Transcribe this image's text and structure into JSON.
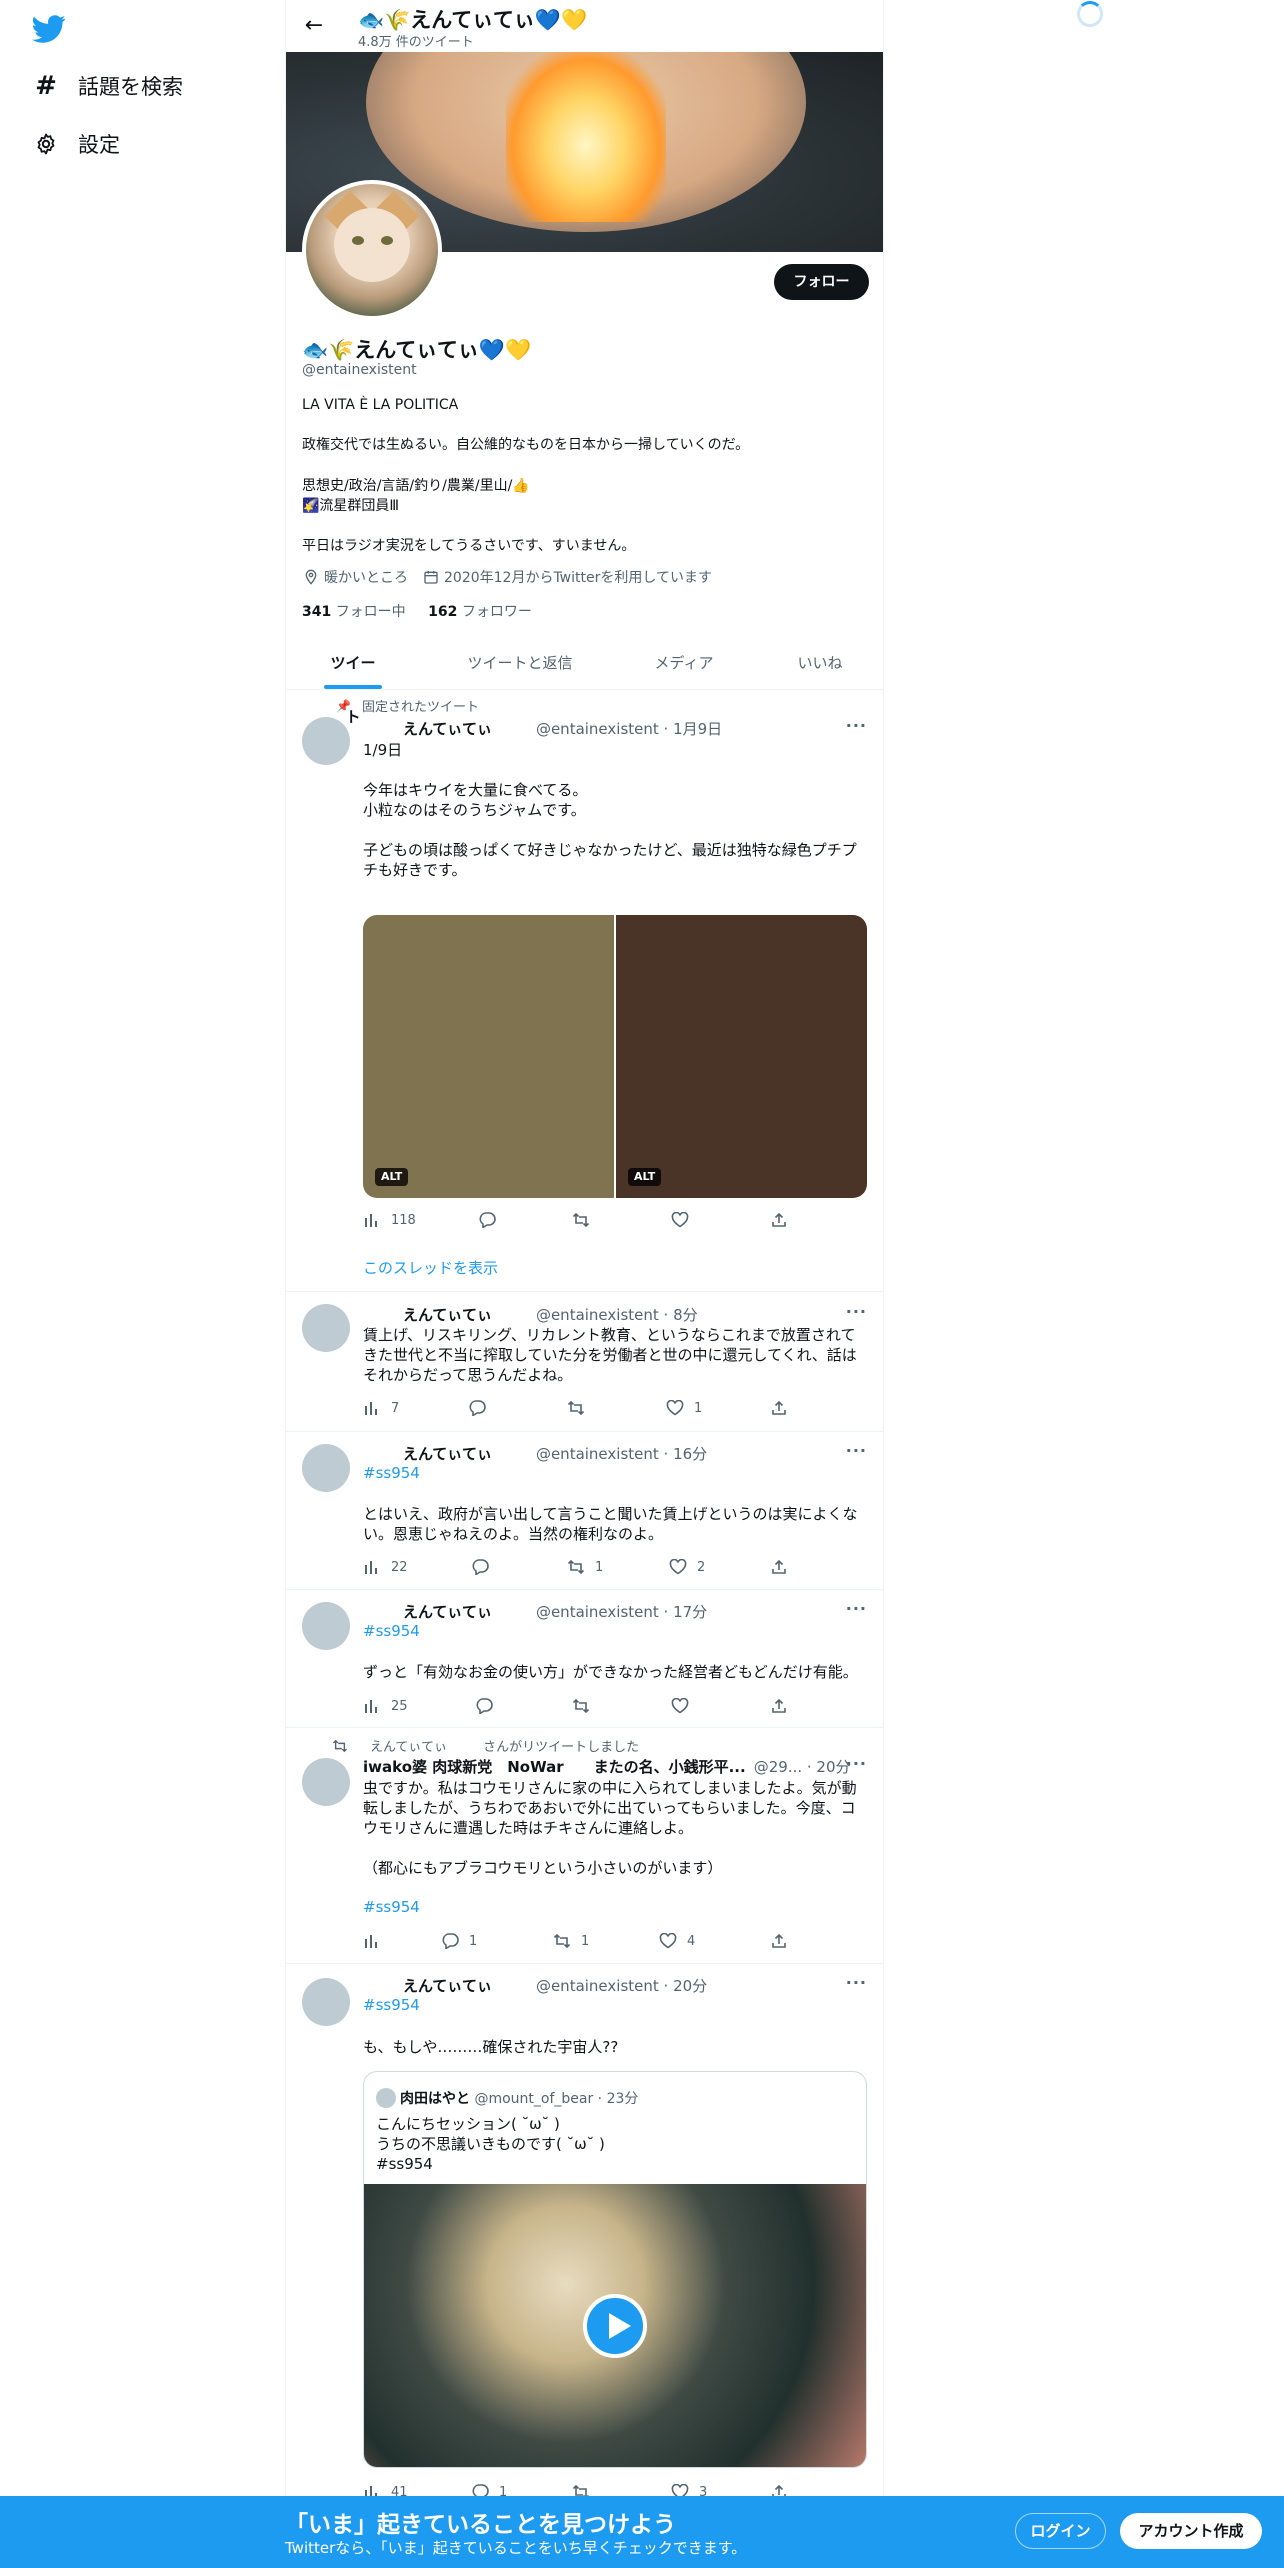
{
  "sidebar": {
    "explore_label": "話題を検索",
    "settings_label": "設定"
  },
  "header": {
    "name": "🐟🌾えんてぃてぃ💙💛",
    "tweet_count": "4.8万 件のツイート"
  },
  "profile": {
    "follow_label": "フォロー",
    "name": "🐟🌾えんてぃてぃ💙💛",
    "handle": "@entainexistent",
    "bio_line1": "LA VITA È LA POLITICA",
    "bio_line2": "政権交代では生ぬるい。自公維的なものを日本から一掃していくのだ。",
    "bio_line3": "思想史/政治/言語/釣り/農業/里山/👍",
    "bio_line4": "🌠流星群団員Ⅲ",
    "bio_line5": "平日はラジオ実況をしてうるさいです、すいません。",
    "location": "暖かいところ",
    "joined": "2020年12月からTwitterを利用しています",
    "following_count": "341",
    "following_label": "フォロー中",
    "followers_count": "162",
    "followers_label": "フォロワー"
  },
  "tabs": [
    "ツイート",
    "ツイートと返信",
    "メディア",
    "いいね"
  ],
  "pinned_label": "固定されたツイート",
  "retweeted_by": "えんてぃてぃ",
  "retweeted_suffix": "さんがリツイートしました",
  "thread_link": "このスレッドを表示",
  "alt_label": "ALT",
  "tweets": [
    {
      "name": "えんてぃてぃ",
      "meta": "@entainexistent · 1月9日",
      "lines": [
        "1/9日",
        "",
        "今年はキウイを大量に食べてる。",
        "小粒なのはそのうちジャムです。",
        "",
        "子どもの頃は酸っぱくて好きじゃなかったけど、最近は独特な緑色プチプ",
        "チも好きです。"
      ],
      "views": "118",
      "replies": "",
      "retweets": "",
      "likes": ""
    },
    {
      "name": "えんてぃてぃ",
      "meta": "@entainexistent · 8分",
      "lines": [
        "賃上げ、リスキリング、リカレント教育、というならこれまで放置されて",
        "きた世代と不当に搾取していた分を労働者と世の中に還元してくれ、話は",
        "それからだって思うんだよね。"
      ],
      "views": "7",
      "replies": "",
      "retweets": "",
      "likes": "1"
    },
    {
      "name": "えんてぃてぃ",
      "meta": "@entainexistent · 16分",
      "tag": "#ss954",
      "lines": [
        "とはいえ、政府が言い出して言うこと聞いた賃上げというのは実によくな",
        "い。恩恵じゃねえのよ。当然の権利なのよ。"
      ],
      "views": "22",
      "replies": "",
      "retweets": "1",
      "likes": "2"
    },
    {
      "name": "えんてぃてぃ",
      "meta": "@entainexistent · 17分",
      "tag": "#ss954",
      "lines": [
        "ずっと「有効なお金の使い方」ができなかった経営者どもどんだけ有能。"
      ],
      "views": "25",
      "replies": "",
      "retweets": "",
      "likes": ""
    },
    {
      "name": "iwako婆 肉球新党　NoWar　　またの名、小銭形平...",
      "meta": "@29... · 20分",
      "lines": [
        "虫ですか。私はコウモリさんに家の中に入られてしまいましたよ。気が動",
        "転しましたが、うちわであおいで外に出ていってもらいました。今度、コ",
        "ウモリさんに遭遇した時はチキさんに連絡しよ。",
        "",
        "（都心にもアブラコウモリという小さいのがいます）"
      ],
      "tag": "#ss954",
      "views": "",
      "replies": "1",
      "retweets": "1",
      "likes": "4"
    },
    {
      "name": "えんてぃてぃ",
      "meta": "@entainexistent · 20分",
      "tag": "#ss954",
      "lines": [
        "も、もしや………確保された宇宙人??"
      ],
      "views": "41",
      "replies": "1",
      "retweets": "",
      "likes": "3"
    }
  ],
  "quote": {
    "name": "肉田はやと",
    "meta": "@mount_of_bear · 23分",
    "lines": [
      "こんにちセッション( ˘ω˘ )",
      "うちの不思議いきものです( ˘ω˘ )",
      "#ss954"
    ]
  },
  "bottom_bar": {
    "title": "「いま」起きていることを見つけよう",
    "subtitle": "Twitterなら、「いま」起きていることをいち早くチェックできます。",
    "login": "ログイン",
    "signup": "アカウント作成"
  },
  "colors": {
    "accent": "#1d9bf0",
    "text": "#0f1419",
    "muted": "#536471"
  },
  "icons": [
    "twitter-logo-icon",
    "hashtag-icon",
    "gear-icon",
    "back-arrow-icon",
    "location-icon",
    "calendar-icon",
    "pin-icon",
    "retweet-icon",
    "views-icon",
    "reply-icon",
    "like-icon",
    "share-icon",
    "more-icon",
    "play-icon",
    "loading-spinner-icon"
  ]
}
